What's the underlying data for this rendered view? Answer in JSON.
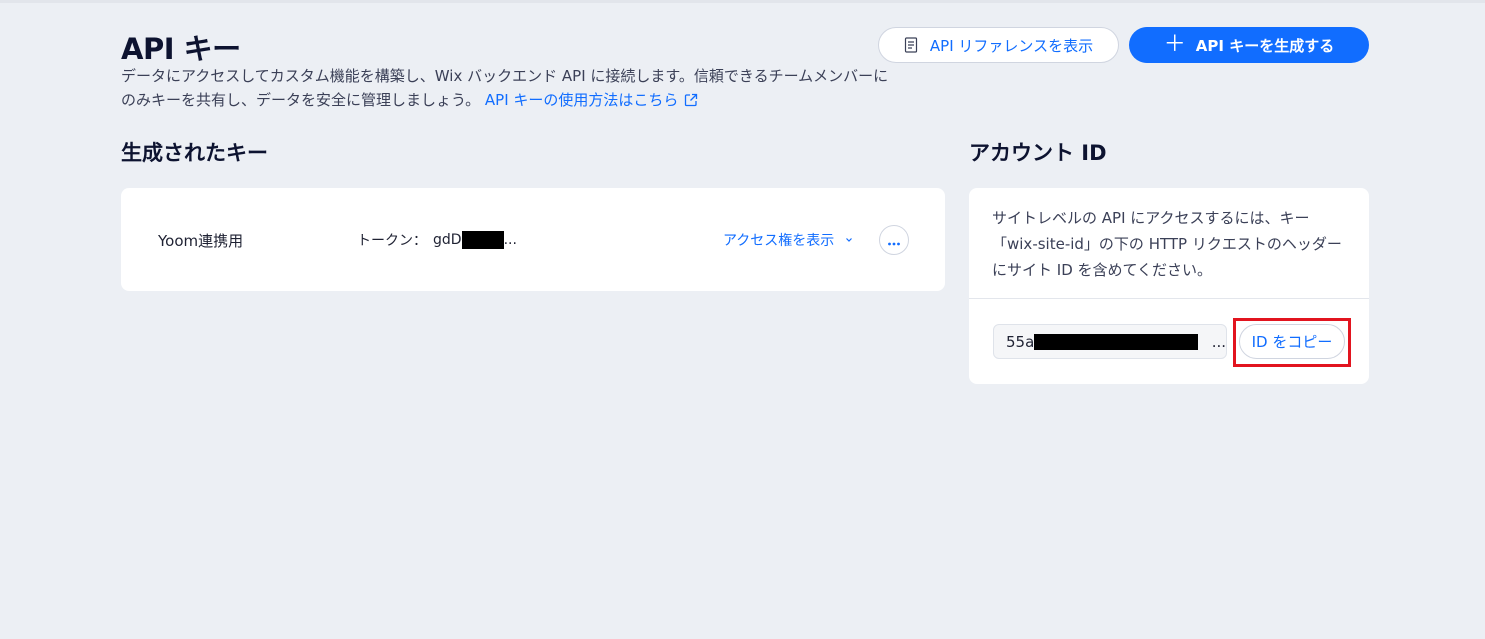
{
  "header": {
    "title": "API キー",
    "description": "データにアクセスしてカスタム機能を構築し、Wix バックエンド API に接続します。信頼できるチームメンバーにのみキーを共有し、データを安全に管理しましょう。",
    "learn_link": "API キーの使用方法はこちら",
    "reference_button": "API リファレンスを表示",
    "create_button": "API キーを生成する"
  },
  "generated_keys": {
    "section_title": "生成されたキー",
    "keys": [
      {
        "name": "Yoom連携用",
        "token_label": "トークン：",
        "token_prefix": "gdD",
        "token_suffix": "...",
        "access_link": "アクセス権を表示"
      }
    ]
  },
  "account": {
    "section_title": "アカウント ID",
    "description": "サイトレベルの API にアクセスするには、キー「wix-site-id」の下の HTTP リクエストのヘッダーにサイト ID を含めてください。",
    "id_prefix": "55a",
    "id_suffix": "...",
    "copy_button": "ID をコピー"
  },
  "colors": {
    "accent": "#116DFF",
    "background": "#ECEFF4",
    "highlight": "#E2141F"
  },
  "icons": {
    "reference": "document-icon",
    "create": "plus-icon",
    "learn_link": "external-link-icon",
    "access": "chevron-down-icon",
    "more": "more-dots-icon"
  }
}
